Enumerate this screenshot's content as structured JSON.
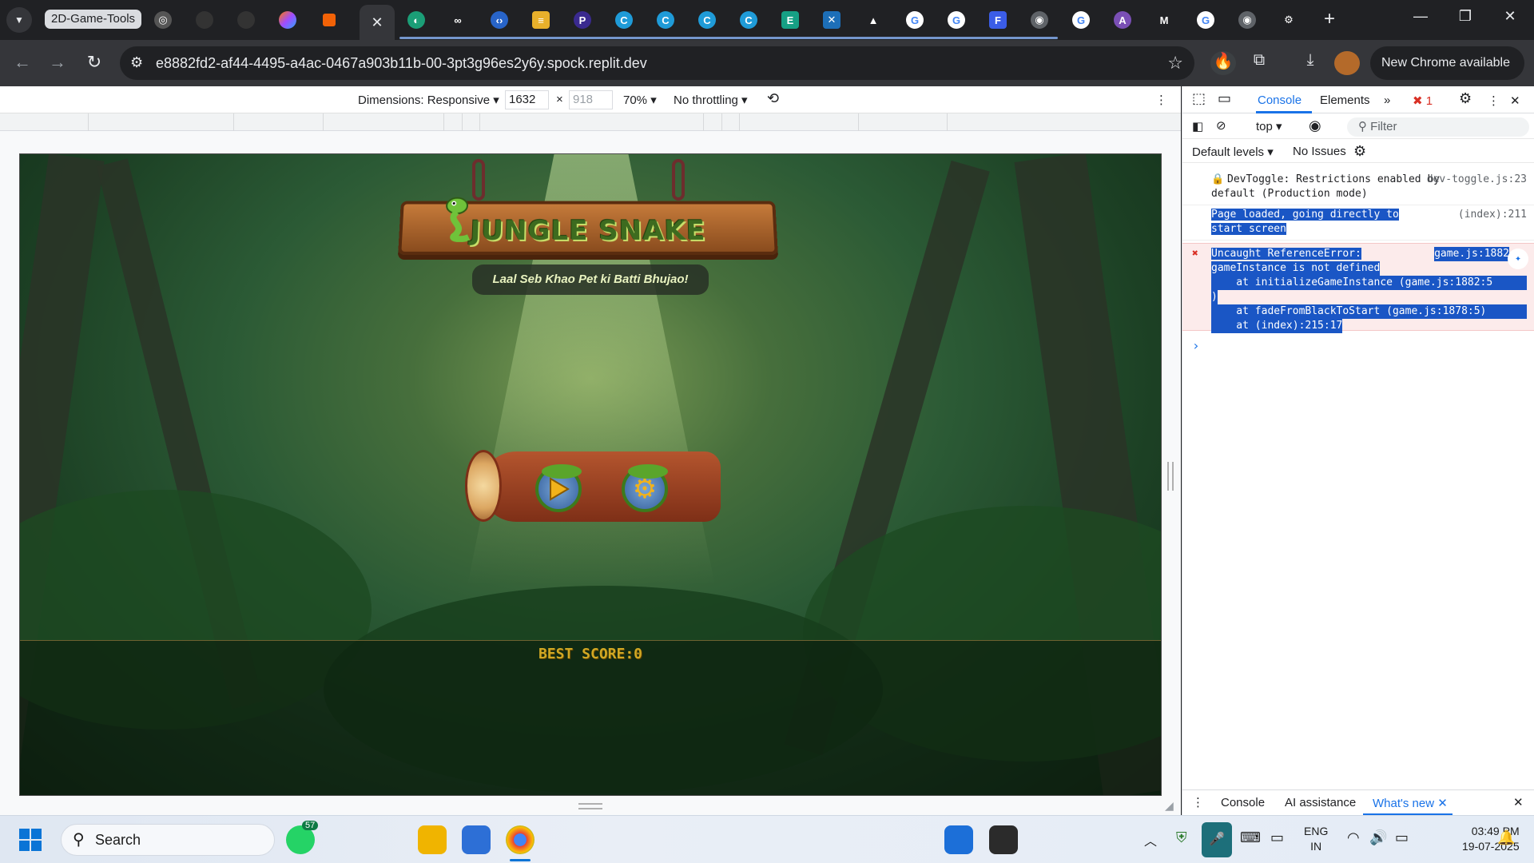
{
  "browser": {
    "tab_group_label": "2D-Game-Tools",
    "url": "e8882fd2-af44-4495-a4ac-0467a903b11b-00-3pt3g96es2y6y.spock.replit.dev",
    "new_chrome_label": "New Chrome available",
    "tab_icons": [
      "openai-icon",
      "github-icon",
      "github-icon",
      "copilot-icon",
      "replit-icon",
      "replit-icon",
      "infinity-icon",
      "code-icon",
      "layer-icon",
      "p-icon",
      "canva-icon",
      "canva-icon",
      "canva-icon",
      "canva-icon",
      "edit-icon",
      "puzzle-icon",
      "triangle-icon",
      "google-icon",
      "google-icon",
      "forms-icon",
      "globe-icon",
      "google-icon",
      "ai-icon",
      "m-icon",
      "google-icon",
      "globe-icon",
      "settings-icon"
    ]
  },
  "devbar": {
    "dimensions_label": "Dimensions: Responsive",
    "width": "1632",
    "height_placeholder": "918",
    "times": "×",
    "zoom": "70%",
    "throttling": "No throttling"
  },
  "game": {
    "title": "JUNGLE SNAKE",
    "tagline": "Laal Seb Khao Pet ki Batti Bhujao!",
    "best_score": "BEST SCORE:0",
    "play_icon": "play-icon",
    "settings_icon": "gear-icon"
  },
  "devtools": {
    "tabs": [
      "Console",
      "Elements"
    ],
    "error_count": "1",
    "context": "top",
    "filter_placeholder": "Filter",
    "levels": "Default levels",
    "issues": "No Issues",
    "messages": [
      {
        "text": "DevToggle: Restrictions enabled by default (Production mode)",
        "src": "dev-toggle.js:23"
      },
      {
        "text": "Page loaded, going directly to start screen",
        "src": "(index):211"
      }
    ],
    "error": {
      "head": "Uncaught ReferenceError:",
      "src": "game.js:1882",
      "line1": "gameInstance is not defined",
      "line2": "    at initializeGameInstance (game.js:1882:5",
      "line3": ")",
      "line4": "    at fadeFromBlackToStart (game.js:1878:5)",
      "line5": "    at (index):215:17"
    },
    "prompt": "›",
    "bottom_tabs": [
      "Console",
      "AI assistance",
      "What's new"
    ]
  },
  "taskbar": {
    "search_label": "Search",
    "whatsapp_badge": "57",
    "lang_top": "ENG",
    "lang_bottom": "IN",
    "time": "03:49 PM",
    "date": "19-07-2025"
  },
  "colors": {
    "accent": "#1a73e8",
    "error": "#a50e0e",
    "score": "#d1a824"
  }
}
